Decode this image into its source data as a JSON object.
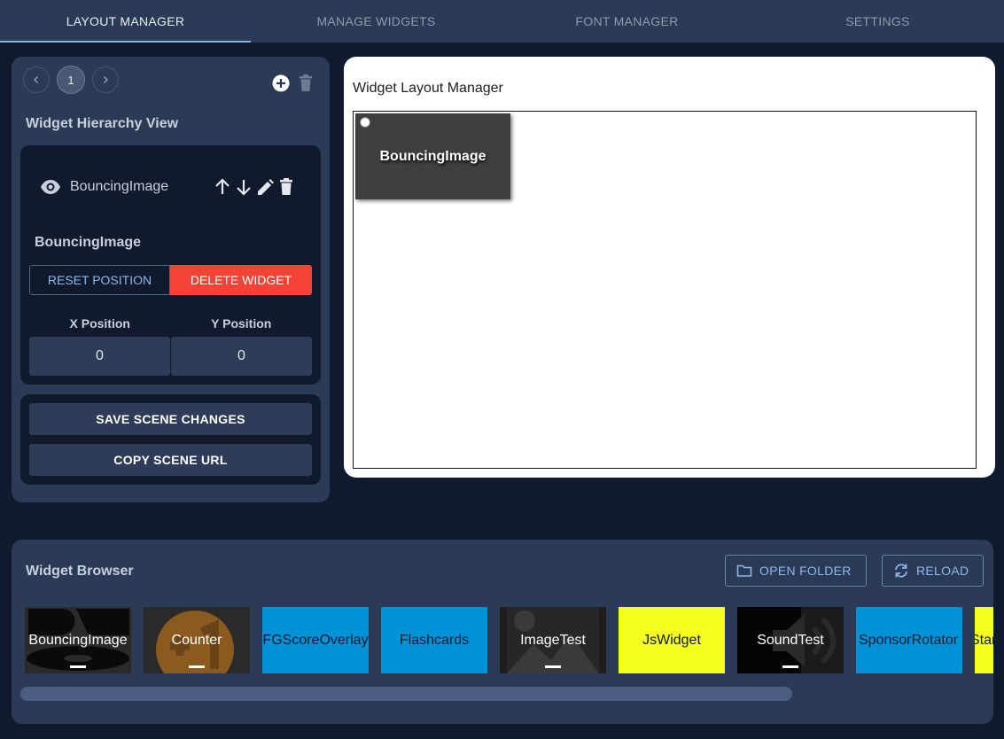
{
  "tabs": [
    {
      "label": "LAYOUT MANAGER"
    },
    {
      "label": "MANAGE WIDGETS"
    },
    {
      "label": "FONT MANAGER"
    },
    {
      "label": "SETTINGS"
    }
  ],
  "pager": {
    "current": "1"
  },
  "hierarchy": {
    "title": "Widget Hierarchy View",
    "item_label": "BouncingImage",
    "selected_name": "BouncingImage",
    "reset_label": "RESET POSITION",
    "delete_label": "DELETE WIDGET",
    "x_label": "X Position",
    "y_label": "Y Position",
    "x_value": "0",
    "y_value": "0"
  },
  "scene": {
    "save_label": "SAVE SCENE CHANGES",
    "copy_label": "COPY SCENE URL"
  },
  "layout": {
    "title": "Widget Layout Manager",
    "widget_label": "BouncingImage"
  },
  "browser": {
    "title": "Widget Browser",
    "open_folder_label": "OPEN FOLDER",
    "reload_label": "RELOAD",
    "tiles": [
      {
        "label": "BouncingImage",
        "color": "#222222"
      },
      {
        "label": "Counter",
        "color": "#2a2a2a"
      },
      {
        "label": "FGScoreOverlay",
        "color": "#0092d6"
      },
      {
        "label": "Flashcards",
        "color": "#0092d6"
      },
      {
        "label": "ImageTest",
        "color": "#1e1e1e"
      },
      {
        "label": "JsWidget",
        "color": "#f5ff1e"
      },
      {
        "label": "SoundTest",
        "color": "#111111"
      },
      {
        "label": "SponsorRotator",
        "color": "#0092d6"
      },
      {
        "label": "Standings",
        "color": "#f5ff1e"
      }
    ]
  },
  "colors": {
    "accent": "#7fb4ef",
    "danger": "#f44336",
    "panel": "#2b3a55",
    "background": "#0f1a2e"
  }
}
